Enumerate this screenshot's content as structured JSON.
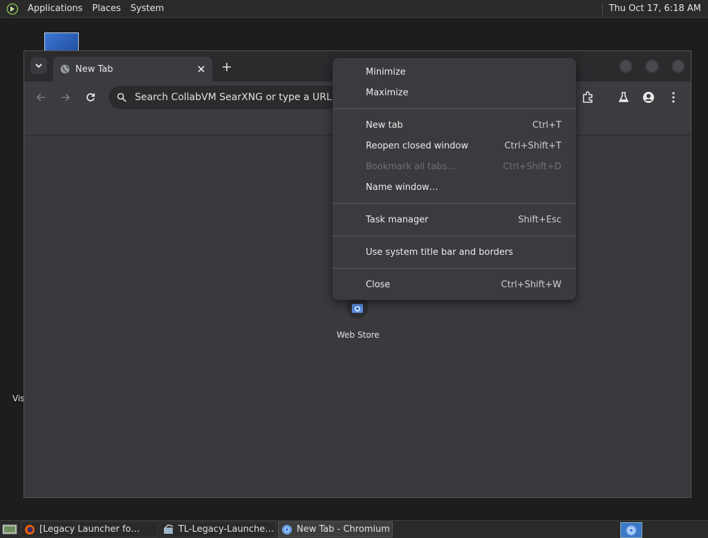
{
  "top_panel": {
    "menus": [
      "Applications",
      "Places",
      "System"
    ],
    "clock": "Thu Oct 17,  6:18 AM"
  },
  "desktop": {
    "partial_label": "Vis"
  },
  "browser": {
    "tab": {
      "title": "New Tab",
      "favicon": "globe-icon"
    },
    "omnibox_placeholder": "Search CollabVM SearXNG or type a URL",
    "shortcut": {
      "label": "Web Store"
    }
  },
  "context_menu": {
    "items": [
      {
        "label": "Minimize",
        "shortcut": "",
        "disabled": false
      },
      {
        "label": "Maximize",
        "shortcut": "",
        "disabled": false
      },
      {
        "label": "New tab",
        "shortcut": "Ctrl+T",
        "disabled": false
      },
      {
        "label": "Reopen closed window",
        "shortcut": "Ctrl+Shift+T",
        "disabled": false
      },
      {
        "label": "Bookmark all tabs…",
        "shortcut": "Ctrl+Shift+D",
        "disabled": true
      },
      {
        "label": "Name window…",
        "shortcut": "",
        "disabled": false
      },
      {
        "label": "Task manager",
        "shortcut": "Shift+Esc",
        "disabled": false
      },
      {
        "label": "Use system title bar and borders",
        "shortcut": "",
        "disabled": false
      },
      {
        "label": "Close",
        "shortcut": "Ctrl+Shift+W",
        "disabled": false
      }
    ]
  },
  "taskbar": {
    "tasks": [
      {
        "label": "[Legacy Launcher fo…",
        "icon": "firefox-icon",
        "active": false
      },
      {
        "label": "TL-Legacy-Launche…",
        "icon": "installer-icon",
        "active": false
      },
      {
        "label": "New Tab - Chromium",
        "icon": "chromium-icon",
        "active": true
      }
    ]
  }
}
